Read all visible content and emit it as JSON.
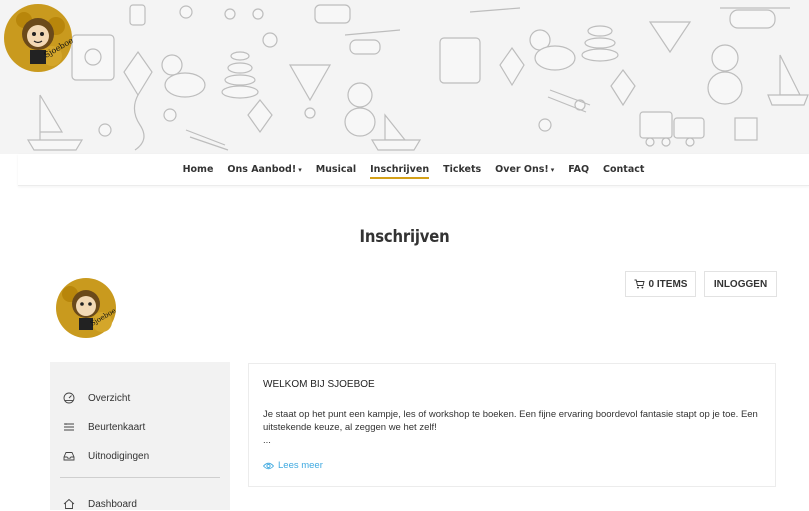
{
  "nav": {
    "items": [
      {
        "label": "Home",
        "has_dropdown": false
      },
      {
        "label": "Ons Aanbod!",
        "has_dropdown": true
      },
      {
        "label": "Musical",
        "has_dropdown": false
      },
      {
        "label": "Inschrijven",
        "has_dropdown": false,
        "active": true
      },
      {
        "label": "Tickets",
        "has_dropdown": false
      },
      {
        "label": "Over Ons!",
        "has_dropdown": true
      },
      {
        "label": "FAQ",
        "has_dropdown": false
      },
      {
        "label": "Contact",
        "has_dropdown": false
      }
    ],
    "dropdown_glyph": "⌄"
  },
  "page": {
    "title": "Inschrijven"
  },
  "header_actions": {
    "cart_label": "0 ITEMS",
    "cart_icon": "cart-icon",
    "login_label": "INLOGGEN"
  },
  "sidebar": {
    "items": [
      {
        "label": "Overzicht",
        "icon": "dashboard-gauge-icon"
      },
      {
        "label": "Beurtenkaart",
        "icon": "list-icon"
      },
      {
        "label": "Uitnodigingen",
        "icon": "inbox-icon"
      },
      {
        "label": "Dashboard",
        "icon": "home-icon"
      }
    ]
  },
  "welcome": {
    "heading": "WELKOM BIJ SJOEBOE",
    "body": "Je staat op het punt een kampje, les of workshop te boeken. Een fijne ervaring boordevol fantasie stapt op je toe. Een uitstekende keuze, al zeggen we het zelf!",
    "ellipsis": "...",
    "more_label": "Lees meer",
    "more_icon": "eye-icon"
  },
  "brand": {
    "logo_text": "Sjoeboe",
    "accent": "#d4a017",
    "link_color": "#3fa9e0"
  }
}
